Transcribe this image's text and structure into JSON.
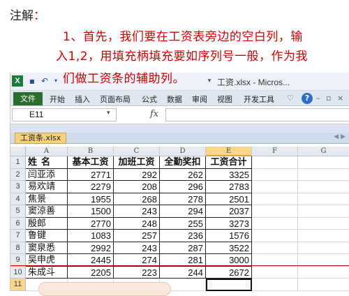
{
  "note": {
    "title": "注解",
    "colon": "：",
    "line1": "1、首先，我们要在工资表旁边的空白列，输",
    "line2": "入1,2，用填充柄填充要如序列号一般，作为我",
    "line3": "们做工资条的辅助列。"
  },
  "window": {
    "title": "工资.xlsx - Micros..."
  },
  "ribbon": {
    "file_label": "文件",
    "tabs": [
      "开始",
      "插入",
      "页面布局",
      "公式",
      "数据",
      "审阅",
      "视图",
      "开发工具"
    ]
  },
  "formula_bar": {
    "name_box": "E11",
    "fx": "fx"
  },
  "workbook_tab": "工资条.xlsx",
  "columns": [
    "A",
    "B",
    "C",
    "D",
    "E",
    "F",
    "G"
  ],
  "rows": [
    "1",
    "2",
    "3",
    "4",
    "5",
    "6",
    "7",
    "8",
    "9",
    "10",
    "11"
  ],
  "table": {
    "headers": [
      "姓名",
      "基本工资",
      "加班工资",
      "全勤奖扣",
      "工资合计"
    ],
    "data": [
      [
        "闫亚添",
        "2771",
        "292",
        "262",
        "3325"
      ],
      [
        "易欢靖",
        "2279",
        "208",
        "296",
        "2783"
      ],
      [
        "焦景",
        "1955",
        "268",
        "278",
        "2501"
      ],
      [
        "窦涼善",
        "1500",
        "243",
        "294",
        "2037"
      ],
      [
        "殷郎",
        "2770",
        "248",
        "255",
        "3273"
      ],
      [
        "鲁键",
        "1083",
        "257",
        "236",
        "1576"
      ],
      [
        "窦泉悉",
        "2992",
        "243",
        "287",
        "3522"
      ],
      [
        "吴申虎",
        "2445",
        "274",
        "281",
        "3000"
      ],
      [
        "朱成斗",
        "2205",
        "223",
        "244",
        "2672"
      ]
    ]
  },
  "colors": {
    "note_red": "#d10000",
    "file_tab_green": "#2a6d2f",
    "selection_orange": "#f8d68c"
  }
}
